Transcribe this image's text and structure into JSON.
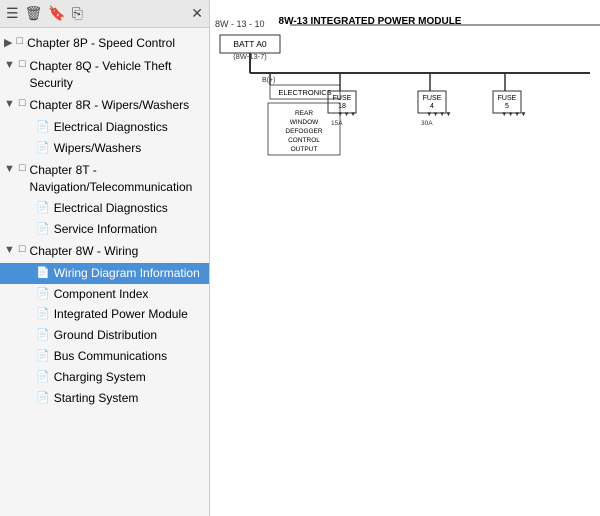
{
  "sidebar": {
    "header_icons": [
      "list-icon",
      "trash-icon",
      "bookmark-icon",
      "share-icon"
    ],
    "close_label": "✕",
    "items": [
      {
        "id": "8p",
        "label": "Chapter 8P - Speed Control",
        "type": "chapter",
        "indent": 0,
        "icon": "▶"
      },
      {
        "id": "8q",
        "label": "Chapter 8Q - Vehicle Theft Security",
        "type": "chapter",
        "indent": 0,
        "icon": "▼"
      },
      {
        "id": "8r",
        "label": "Chapter 8R - Wipers/Washers",
        "type": "chapter",
        "indent": 0,
        "icon": "▼"
      },
      {
        "id": "8r-elec",
        "label": "Electrical Diagnostics",
        "type": "sub",
        "indent": 1,
        "icon": "📄"
      },
      {
        "id": "8r-ww",
        "label": "Wipers/Washers",
        "type": "sub",
        "indent": 1,
        "icon": "📄"
      },
      {
        "id": "8t",
        "label": "Chapter 8T - Navigation/Telecommunication",
        "type": "chapter",
        "indent": 0,
        "icon": "▼"
      },
      {
        "id": "8t-elec",
        "label": "Electrical Diagnostics",
        "type": "sub",
        "indent": 1,
        "icon": "📄"
      },
      {
        "id": "8t-svc",
        "label": "Service Information",
        "type": "sub",
        "indent": 1,
        "icon": "📄"
      },
      {
        "id": "8w",
        "label": "Chapter 8W - Wiring",
        "type": "chapter",
        "indent": 0,
        "icon": "▼"
      },
      {
        "id": "8w-wdi",
        "label": "Wiring Diagram Information",
        "type": "sub",
        "indent": 1,
        "icon": "📄",
        "selected": true
      },
      {
        "id": "8w-ci",
        "label": "Component Index",
        "type": "sub",
        "indent": 1,
        "icon": "📄"
      },
      {
        "id": "8w-ipm",
        "label": "Integrated Power Module",
        "type": "sub",
        "indent": 1,
        "icon": "📄"
      },
      {
        "id": "8w-gd",
        "label": "Ground Distribution",
        "type": "sub",
        "indent": 1,
        "icon": "📄"
      },
      {
        "id": "8w-bc",
        "label": "Bus Communications",
        "type": "sub",
        "indent": 1,
        "icon": "📄"
      },
      {
        "id": "8w-cs",
        "label": "Charging System",
        "type": "sub",
        "indent": 1,
        "icon": "📄"
      },
      {
        "id": "8w-ss",
        "label": "Starting System",
        "type": "sub",
        "indent": 1,
        "icon": "📄"
      }
    ]
  },
  "diagram": {
    "page_ref": "8W - 13 - 10",
    "title": "8W-13 INTEGRATED POWER MODULE",
    "batt_label": "BATT A0",
    "batt_ref": "(8W-13-7)"
  }
}
